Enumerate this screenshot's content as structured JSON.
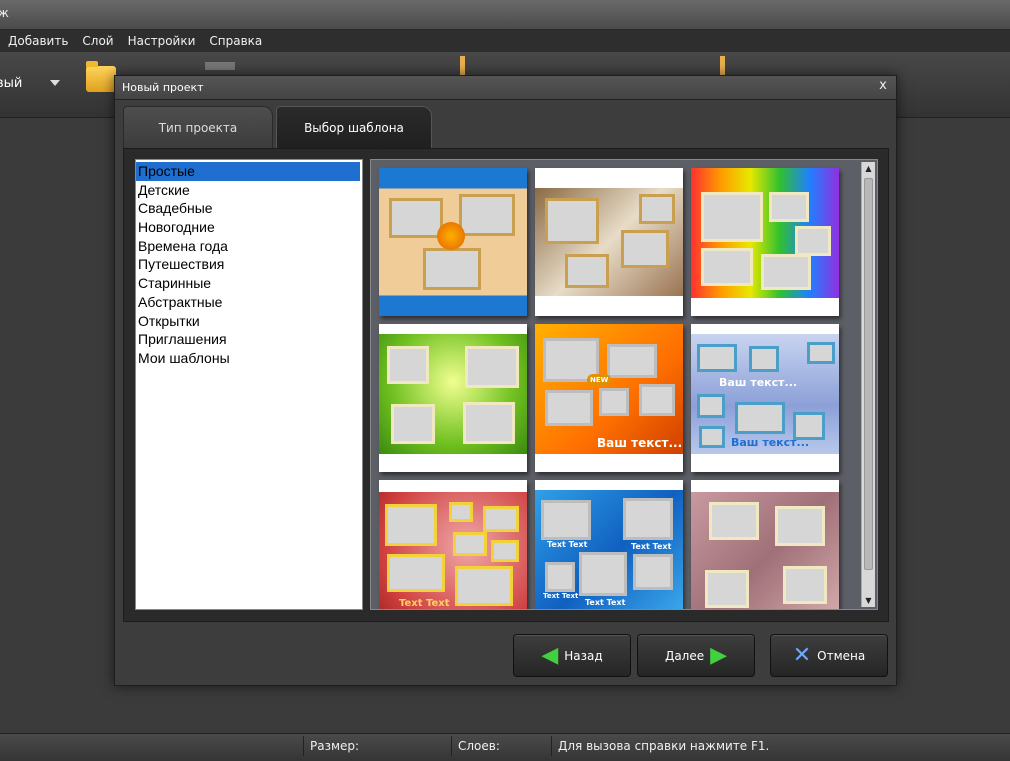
{
  "window": {
    "title_fragment": "ж"
  },
  "menu": {
    "items": [
      "Добавить",
      "Слой",
      "Настройки",
      "Справка"
    ]
  },
  "toolbar": {
    "new_label": "вый"
  },
  "dialog": {
    "title": "Новый проект",
    "close_glyph": "x",
    "tabs": [
      {
        "label": "Тип проекта",
        "active": false
      },
      {
        "label": "Выбор шаблона",
        "active": true
      }
    ],
    "categories": [
      "Простые",
      "Детские",
      "Свадебные",
      "Новогодние",
      "Времена года",
      "Путешествия",
      "Старинные",
      "Абстрактные",
      "Открытки",
      "Приглашения",
      "Мои шаблоны"
    ],
    "selected_category": "Простые",
    "template_captions": {
      "t5": "Ваш текст...",
      "t6a": "Ваш текст...",
      "t6b": "Ваш текст...",
      "t7": "Text Text",
      "t8a": "Text Text",
      "t8b": "Text Text",
      "t8c": "Text Text",
      "t8d": "Text Text",
      "t5badge": "NEW"
    },
    "buttons": {
      "back": "Назад",
      "next": "Далее",
      "cancel": "Отмена"
    }
  },
  "status": {
    "size_label": "Размер:",
    "layers_label": "Слоев:",
    "help": "Для вызова справки нажмите F1."
  },
  "colors": {
    "selection": "#1e6fd0",
    "accent_green": "#40d040",
    "cancel_blue": "#6aa8ff"
  }
}
